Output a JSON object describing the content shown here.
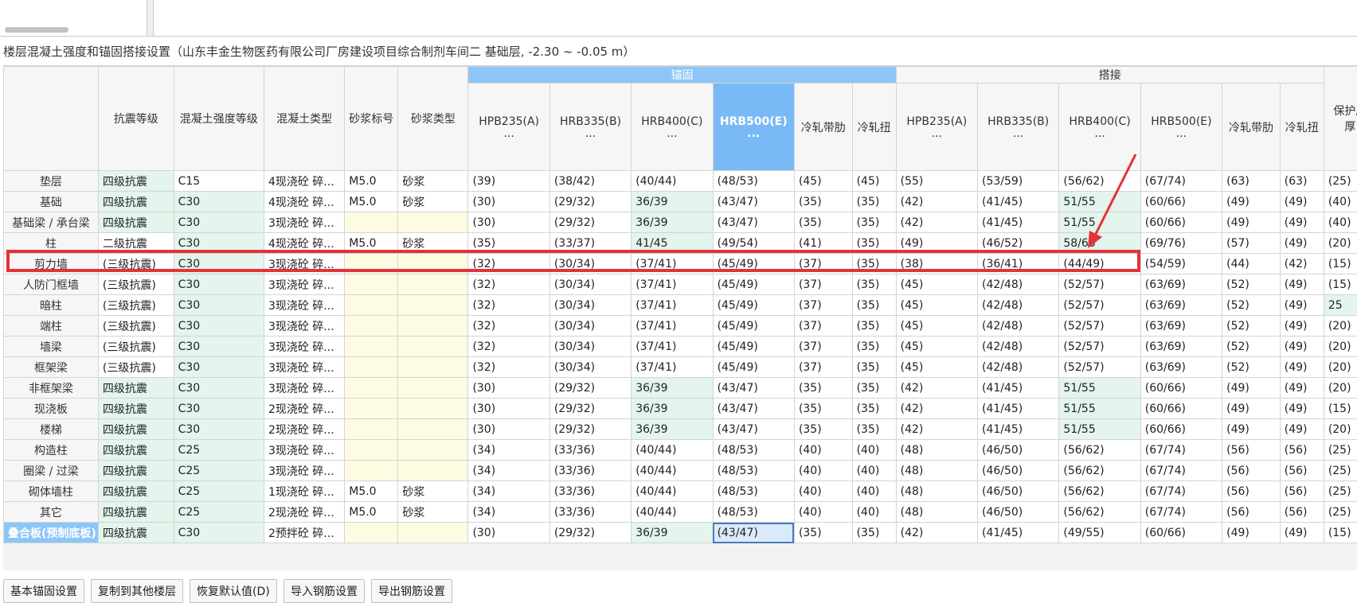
{
  "caption": "楼层混凝土强度和锚固搭接设置（山东丰金生物医药有限公司厂房建设项目综合制剂车间二  基础层, -2.30 ~ -0.05 m）",
  "groups": {
    "anchor": "锚固",
    "lap": "搭接"
  },
  "columns": {
    "seismic": "抗震等级",
    "concrete_grade": "混凝土强度等级",
    "concrete_type": "混凝土类型",
    "mortar_grade": "砂浆标号",
    "mortar_type": "砂浆类型",
    "anchor": [
      "HPB235(A)",
      "HRB335(B)",
      "HRB400(C)",
      "HRB500(E)",
      "冷轧带肋",
      "冷轧扭"
    ],
    "lap": [
      "HPB235(A)",
      "HRB335(B)",
      "HRB400(C)",
      "HRB500(E)",
      "冷轧带肋",
      "冷轧扭"
    ],
    "cover": "保护层厚",
    "dots": "..."
  },
  "rows": [
    {
      "name": "垫层",
      "seismic": "四级抗震",
      "grade": "C15",
      "ctype": "4现浇砼 碎...",
      "mgrade": "M5.0",
      "mtype": "砂浆",
      "a": [
        "(39)",
        "(38/42)",
        "(40/44)",
        "(48/53)",
        "(45)",
        "(45)"
      ],
      "l": [
        "(55)",
        "(53/59)",
        "(56/62)",
        "(67/74)",
        "(63)",
        "(63)"
      ],
      "cover": "(25)"
    },
    {
      "name": "基础",
      "seismic": "四级抗震",
      "grade": "C30",
      "ctype": "4现浇砼 碎...",
      "mgrade": "M5.0",
      "mtype": "砂浆",
      "a": [
        "(30)",
        "(29/32)",
        "36/39",
        "(43/47)",
        "(35)",
        "(35)"
      ],
      "l": [
        "(42)",
        "(41/45)",
        "51/55",
        "(60/66)",
        "(49)",
        "(49)"
      ],
      "cover": "(40)"
    },
    {
      "name": "基础梁 / 承台梁",
      "seismic": "四级抗震",
      "grade": "C30",
      "ctype": "3现浇砼 碎...",
      "mgrade": "",
      "mtype": "",
      "a": [
        "(30)",
        "(29/32)",
        "36/39",
        "(43/47)",
        "(35)",
        "(35)"
      ],
      "l": [
        "(42)",
        "(41/45)",
        "51/55",
        "(60/66)",
        "(49)",
        "(49)"
      ],
      "cover": "(40)"
    },
    {
      "name": "柱",
      "seismic": "二级抗震",
      "grade": "C30",
      "ctype": "4现浇砼 碎...",
      "mgrade": "M5.0",
      "mtype": "砂浆",
      "a": [
        "(35)",
        "(33/37)",
        "41/45",
        "(49/54)",
        "(41)",
        "(35)"
      ],
      "l": [
        "(49)",
        "(46/52)",
        "58/63",
        "(69/76)",
        "(57)",
        "(49)"
      ],
      "cover": "(20)"
    },
    {
      "name": "剪力墙",
      "seismic": "(三级抗震)",
      "grade": "C30",
      "ctype": "3现浇砼 碎...",
      "mgrade": "",
      "mtype": "",
      "a": [
        "(32)",
        "(30/34)",
        "(37/41)",
        "(45/49)",
        "(37)",
        "(35)"
      ],
      "l": [
        "(38)",
        "(36/41)",
        "(44/49)",
        "(54/59)",
        "(44)",
        "(42)"
      ],
      "cover": "(15)"
    },
    {
      "name": "人防门框墙",
      "seismic": "(三级抗震)",
      "grade": "C30",
      "ctype": "3现浇砼 碎...",
      "mgrade": "",
      "mtype": "",
      "a": [
        "(32)",
        "(30/34)",
        "(37/41)",
        "(45/49)",
        "(37)",
        "(35)"
      ],
      "l": [
        "(45)",
        "(42/48)",
        "(52/57)",
        "(63/69)",
        "(52)",
        "(49)"
      ],
      "cover": "(15)"
    },
    {
      "name": "暗柱",
      "seismic": "(三级抗震)",
      "grade": "C30",
      "ctype": "3现浇砼 碎...",
      "mgrade": "",
      "mtype": "",
      "a": [
        "(32)",
        "(30/34)",
        "(37/41)",
        "(45/49)",
        "(37)",
        "(35)"
      ],
      "l": [
        "(45)",
        "(42/48)",
        "(52/57)",
        "(63/69)",
        "(52)",
        "(49)"
      ],
      "cover": "25"
    },
    {
      "name": "端柱",
      "seismic": "(三级抗震)",
      "grade": "C30",
      "ctype": "3现浇砼 碎...",
      "mgrade": "",
      "mtype": "",
      "a": [
        "(32)",
        "(30/34)",
        "(37/41)",
        "(45/49)",
        "(37)",
        "(35)"
      ],
      "l": [
        "(45)",
        "(42/48)",
        "(52/57)",
        "(63/69)",
        "(52)",
        "(49)"
      ],
      "cover": "(20)"
    },
    {
      "name": "墙梁",
      "seismic": "(三级抗震)",
      "grade": "C30",
      "ctype": "3现浇砼 碎...",
      "mgrade": "",
      "mtype": "",
      "a": [
        "(32)",
        "(30/34)",
        "(37/41)",
        "(45/49)",
        "(37)",
        "(35)"
      ],
      "l": [
        "(45)",
        "(42/48)",
        "(52/57)",
        "(63/69)",
        "(52)",
        "(49)"
      ],
      "cover": "(20)"
    },
    {
      "name": "框架梁",
      "seismic": "(三级抗震)",
      "grade": "C30",
      "ctype": "3现浇砼 碎...",
      "mgrade": "",
      "mtype": "",
      "a": [
        "(32)",
        "(30/34)",
        "(37/41)",
        "(45/49)",
        "(37)",
        "(35)"
      ],
      "l": [
        "(45)",
        "(42/48)",
        "(52/57)",
        "(63/69)",
        "(52)",
        "(49)"
      ],
      "cover": "(20)"
    },
    {
      "name": "非框架梁",
      "seismic": "四级抗震",
      "grade": "C30",
      "ctype": "3现浇砼 碎...",
      "mgrade": "",
      "mtype": "",
      "a": [
        "(30)",
        "(29/32)",
        "36/39",
        "(43/47)",
        "(35)",
        "(35)"
      ],
      "l": [
        "(42)",
        "(41/45)",
        "51/55",
        "(60/66)",
        "(49)",
        "(49)"
      ],
      "cover": "(20)"
    },
    {
      "name": "现浇板",
      "seismic": "四级抗震",
      "grade": "C30",
      "ctype": "2现浇砼 碎...",
      "mgrade": "",
      "mtype": "",
      "a": [
        "(30)",
        "(29/32)",
        "36/39",
        "(43/47)",
        "(35)",
        "(35)"
      ],
      "l": [
        "(42)",
        "(41/45)",
        "51/55",
        "(60/66)",
        "(49)",
        "(49)"
      ],
      "cover": "(15)"
    },
    {
      "name": "楼梯",
      "seismic": "四级抗震",
      "grade": "C30",
      "ctype": "2现浇砼 碎...",
      "mgrade": "",
      "mtype": "",
      "a": [
        "(30)",
        "(29/32)",
        "36/39",
        "(43/47)",
        "(35)",
        "(35)"
      ],
      "l": [
        "(42)",
        "(41/45)",
        "51/55",
        "(60/66)",
        "(49)",
        "(49)"
      ],
      "cover": "(20)"
    },
    {
      "name": "构造柱",
      "seismic": "四级抗震",
      "grade": "C25",
      "ctype": "3现浇砼 碎...",
      "mgrade": "",
      "mtype": "",
      "a": [
        "(34)",
        "(33/36)",
        "(40/44)",
        "(48/53)",
        "(40)",
        "(40)"
      ],
      "l": [
        "(48)",
        "(46/50)",
        "(56/62)",
        "(67/74)",
        "(56)",
        "(56)"
      ],
      "cover": "(25)"
    },
    {
      "name": "圈梁 / 过梁",
      "seismic": "四级抗震",
      "grade": "C25",
      "ctype": "3现浇砼 碎...",
      "mgrade": "",
      "mtype": "",
      "a": [
        "(34)",
        "(33/36)",
        "(40/44)",
        "(48/53)",
        "(40)",
        "(40)"
      ],
      "l": [
        "(48)",
        "(46/50)",
        "(56/62)",
        "(67/74)",
        "(56)",
        "(56)"
      ],
      "cover": "(25)"
    },
    {
      "name": "砌体墙柱",
      "seismic": "四级抗震",
      "grade": "C25",
      "ctype": "1现浇砼 碎...",
      "mgrade": "M5.0",
      "mtype": "砂浆",
      "a": [
        "(34)",
        "(33/36)",
        "(40/44)",
        "(48/53)",
        "(40)",
        "(40)"
      ],
      "l": [
        "(48)",
        "(46/50)",
        "(56/62)",
        "(67/74)",
        "(56)",
        "(56)"
      ],
      "cover": "(25)"
    },
    {
      "name": "其它",
      "seismic": "四级抗震",
      "grade": "C25",
      "ctype": "2现浇砼 碎...",
      "mgrade": "M5.0",
      "mtype": "砂浆",
      "a": [
        "(34)",
        "(33/36)",
        "(40/44)",
        "(48/53)",
        "(40)",
        "(40)"
      ],
      "l": [
        "(48)",
        "(46/50)",
        "(56/62)",
        "(67/74)",
        "(56)",
        "(56)"
      ],
      "cover": "(25)"
    },
    {
      "name": "叠合板(预制底板)",
      "seismic": "四级抗震",
      "grade": "C30",
      "ctype": "2预拌砼 碎...",
      "mgrade": "",
      "mtype": "",
      "a": [
        "(30)",
        "(29/32)",
        "36/39",
        "(43/47)",
        "(35)",
        "(35)"
      ],
      "l": [
        "(42)",
        "(41/45)",
        "(49/55)",
        "(60/66)",
        "(49)",
        "(49)"
      ],
      "cover": "(15)"
    }
  ],
  "buttons": [
    "基本锚固设置",
    "复制到其他楼层",
    "恢复默认值(D)",
    "导入钢筋设置",
    "导出钢筋设置"
  ],
  "colors": {
    "selected_header": "#79b9f5",
    "edited_green": "#e3f5ec",
    "editable_yellow": "#fdfbe1",
    "highlight_red": "#e53138"
  }
}
